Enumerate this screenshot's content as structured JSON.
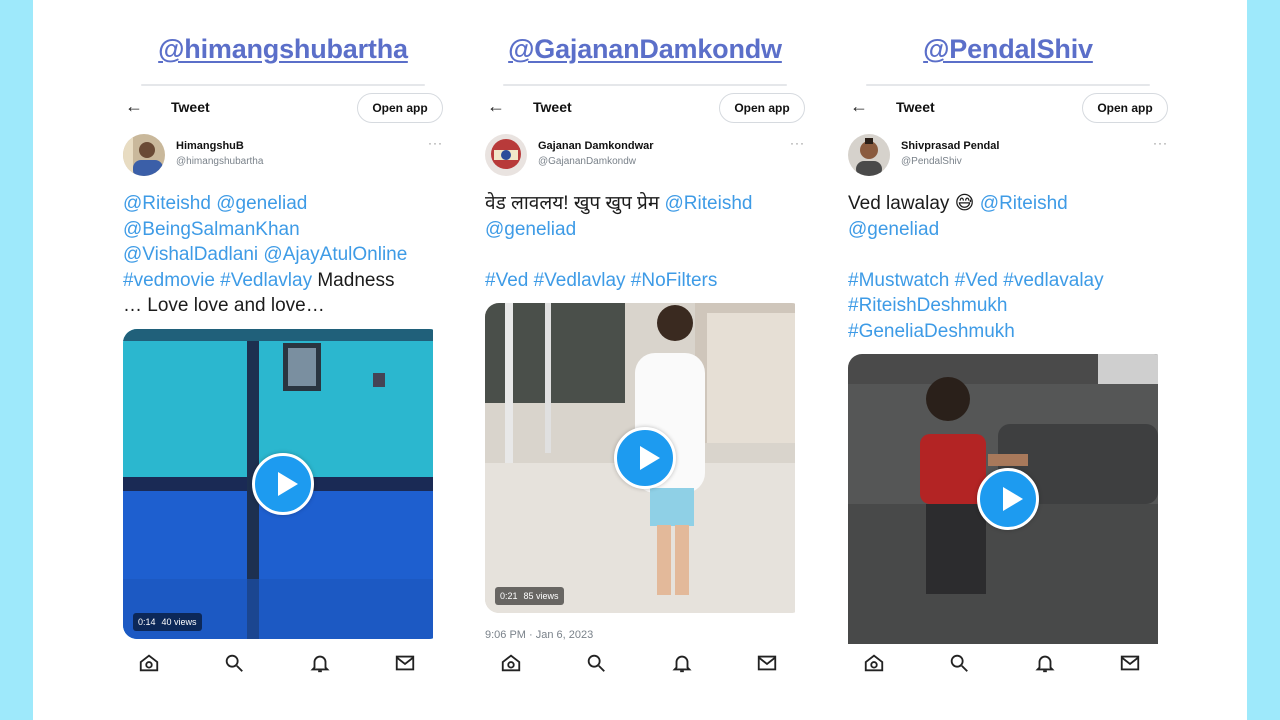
{
  "columns": [
    {
      "handle": "@himangshubartha",
      "topbar": {
        "back": "←",
        "title": "Tweet",
        "open_app": "Open app"
      },
      "author": {
        "name": "HimangshuB",
        "username": "@himangshubartha"
      },
      "more": "···",
      "text_tokens": [
        {
          "t": "@Riteishd",
          "tag": true
        },
        {
          "t": " ",
          "tag": false
        },
        {
          "t": "@geneliad",
          "tag": true
        },
        {
          "t": "\n",
          "tag": false
        },
        {
          "t": "@BeingSalmanKhan",
          "tag": true
        },
        {
          "t": "\n",
          "tag": false
        },
        {
          "t": "@VishalDadlani",
          "tag": true
        },
        {
          "t": " ",
          "tag": false
        },
        {
          "t": "@AjayAtulOnline",
          "tag": true
        },
        {
          "t": "\n",
          "tag": false
        },
        {
          "t": "#vedmovie",
          "tag": true
        },
        {
          "t": "  ",
          "tag": false
        },
        {
          "t": "#Vedlavlay",
          "tag": true
        },
        {
          "t": "  Madness\n… Love love and love…",
          "tag": false
        }
      ],
      "video": {
        "duration": "0:14",
        "views": "40 views"
      },
      "timestamp": ""
    },
    {
      "handle": "@GajananDamkondw",
      "topbar": {
        "back": "←",
        "title": "Tweet",
        "open_app": "Open app"
      },
      "author": {
        "name": "Gajanan Damkondwar",
        "username": "@GajananDamkondw"
      },
      "more": "···",
      "text_tokens": [
        {
          "t": "वेड लावलय! खुप खुप प्रेम ",
          "tag": false
        },
        {
          "t": "@Riteishd",
          "tag": true
        },
        {
          "t": "\n",
          "tag": false
        },
        {
          "t": "@geneliad",
          "tag": true
        },
        {
          "t": "\n\n",
          "tag": false
        },
        {
          "t": "#Ved",
          "tag": true
        },
        {
          "t": " ",
          "tag": false
        },
        {
          "t": "#Vedlavlay",
          "tag": true
        },
        {
          "t": " ",
          "tag": false
        },
        {
          "t": "#NoFilters",
          "tag": true
        }
      ],
      "video": {
        "duration": "0:21",
        "views": "85 views"
      },
      "timestamp": "9:06 PM · Jan 6, 2023"
    },
    {
      "handle": "@PendalShiv",
      "topbar": {
        "back": "←",
        "title": "Tweet",
        "open_app": "Open app"
      },
      "author": {
        "name": "Shivprasad Pendal",
        "username": "@PendalShiv"
      },
      "more": "···",
      "text_tokens": [
        {
          "t": "Ved lawalay 😅 ",
          "tag": false
        },
        {
          "t": "@Riteishd",
          "tag": true
        },
        {
          "t": "\n",
          "tag": false
        },
        {
          "t": "@geneliad",
          "tag": true
        },
        {
          "t": "\n\n",
          "tag": false
        },
        {
          "t": "#Mustwatch",
          "tag": true
        },
        {
          "t": " ",
          "tag": false
        },
        {
          "t": "#Ved",
          "tag": true
        },
        {
          "t": " ",
          "tag": false
        },
        {
          "t": "#vedlavalay",
          "tag": true
        },
        {
          "t": "\n",
          "tag": false
        },
        {
          "t": "#RiteishDeshmukh",
          "tag": true
        },
        {
          "t": "\n",
          "tag": false
        },
        {
          "t": "#GeneliaDeshmukh",
          "tag": true
        }
      ],
      "video": {
        "duration": "",
        "views": ""
      },
      "timestamp": ""
    }
  ],
  "icons": {
    "back": "back-arrow-icon",
    "more": "more-options-icon",
    "play": "play-icon",
    "nav": [
      "home-icon",
      "search-icon",
      "notifications-icon",
      "messages-icon"
    ]
  },
  "colors": {
    "outer_background": "#9ee9fb",
    "handle_link": "#5b6fc9",
    "hashtag_mention": "#3e9be6",
    "play_button": "#1d9bf0"
  }
}
